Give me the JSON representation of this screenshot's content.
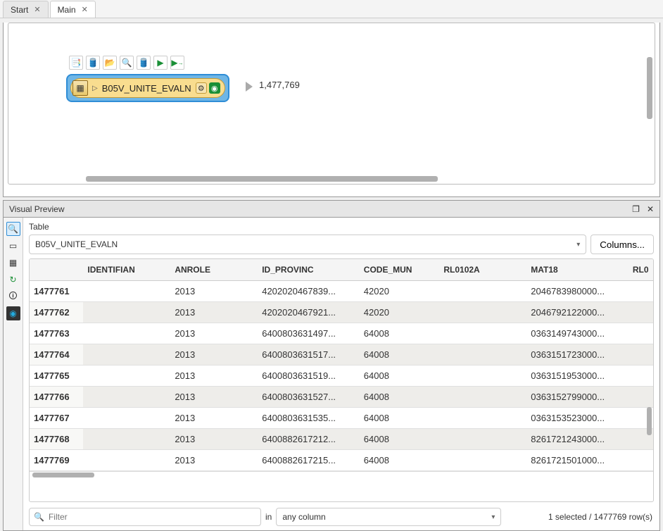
{
  "tabs": [
    {
      "label": "Start"
    },
    {
      "label": "Main"
    }
  ],
  "node": {
    "label": "B05V_UNITE_EVALN",
    "count": "1,477,769"
  },
  "visual_preview": {
    "title": "Visual Preview",
    "table_label": "Table",
    "dataset": "B05V_UNITE_EVALN",
    "columns_btn": "Columns..."
  },
  "table": {
    "headers": [
      "IDENTIFIAN",
      "ANROLE",
      "ID_PROVINC",
      "CODE_MUN",
      "RL0102A",
      "MAT18",
      "RL0"
    ],
    "rows": [
      {
        "n": "1477761",
        "identifian": "<missing>",
        "anrole": "2013",
        "id_provinc": "4202020467839...",
        "code_mun": "42020",
        "rl0102a": "<missing>",
        "mat18": "2046783980000...",
        "rl0": "<mi"
      },
      {
        "n": "1477762",
        "identifian": "<missing>",
        "anrole": "2013",
        "id_provinc": "4202020467921...",
        "code_mun": "42020",
        "rl0102a": "<missing>",
        "mat18": "2046792122000...",
        "rl0": "<mi"
      },
      {
        "n": "1477763",
        "identifian": "<missing>",
        "anrole": "2013",
        "id_provinc": "6400803631497...",
        "code_mun": "64008",
        "rl0102a": "<missing>",
        "mat18": "0363149743000...",
        "rl0": "<mi"
      },
      {
        "n": "1477764",
        "identifian": "<missing>",
        "anrole": "2013",
        "id_provinc": "6400803631517...",
        "code_mun": "64008",
        "rl0102a": "<missing>",
        "mat18": "0363151723000...",
        "rl0": "<mi"
      },
      {
        "n": "1477765",
        "identifian": "<missing>",
        "anrole": "2013",
        "id_provinc": "6400803631519...",
        "code_mun": "64008",
        "rl0102a": "<missing>",
        "mat18": "0363151953000...",
        "rl0": "<mi"
      },
      {
        "n": "1477766",
        "identifian": "<missing>",
        "anrole": "2013",
        "id_provinc": "6400803631527...",
        "code_mun": "64008",
        "rl0102a": "<missing>",
        "mat18": "0363152799000...",
        "rl0": "<mi"
      },
      {
        "n": "1477767",
        "identifian": "<missing>",
        "anrole": "2013",
        "id_provinc": "6400803631535...",
        "code_mun": "64008",
        "rl0102a": "<missing>",
        "mat18": "0363153523000...",
        "rl0": "<mi"
      },
      {
        "n": "1477768",
        "identifian": "<missing>",
        "anrole": "2013",
        "id_provinc": "6400882617212...",
        "code_mun": "64008",
        "rl0102a": "<missing>",
        "mat18": "8261721243000...",
        "rl0": "<mi"
      },
      {
        "n": "1477769",
        "identifian": "<missing>",
        "anrole": "2013",
        "id_provinc": "6400882617215...",
        "code_mun": "64008",
        "rl0102a": "<missing>",
        "mat18": "8261721501000...",
        "rl0": "<mi"
      }
    ]
  },
  "filter": {
    "placeholder": "Filter",
    "in": "in",
    "column": "any column",
    "status": "1 selected / 1477769 row(s)"
  }
}
